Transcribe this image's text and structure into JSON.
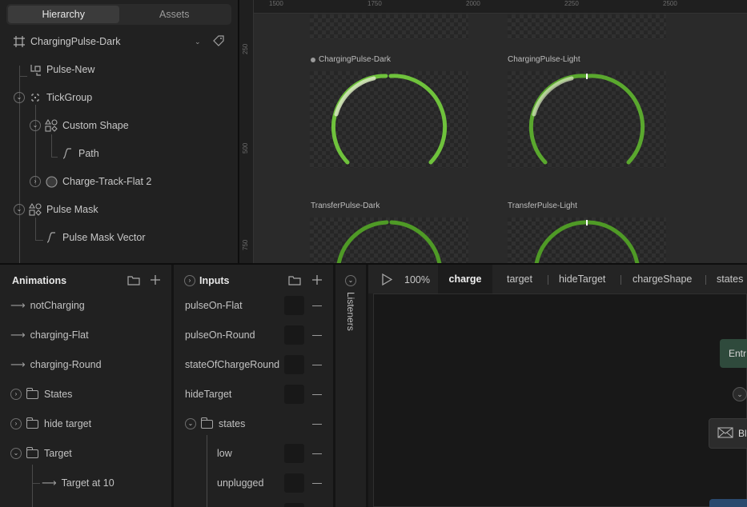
{
  "hierarchy": {
    "tabs": [
      "Hierarchy",
      "Assets"
    ],
    "artboard_name": "ChargingPulse-Dark",
    "items": [
      {
        "label": "Pulse-New",
        "icon": "bone-icon"
      },
      {
        "label": "TickGroup",
        "icon": "group-icon"
      },
      {
        "label": "Custom Shape",
        "icon": "shape-icon"
      },
      {
        "label": "Path",
        "icon": "path-icon"
      },
      {
        "label": "Charge-Track-Flat 2",
        "icon": "ellipse-icon"
      },
      {
        "label": "Pulse Mask",
        "icon": "shape-icon"
      },
      {
        "label": "Pulse Mask Vector",
        "icon": "path-icon"
      }
    ]
  },
  "canvas": {
    "ruler_x": [
      "1500",
      "1750",
      "2000",
      "2250",
      "2500"
    ],
    "ruler_y": [
      "250",
      "500",
      "750"
    ],
    "artboards": [
      "ChargingPulse-Dark",
      "ChargingPulse-Light",
      "TransferPulse-Dark",
      "TransferPulse-Light"
    ],
    "colors": {
      "arc_bright": "#6fc23c",
      "arc_dark": "#4f9a26",
      "highlight": "#d8e8c0"
    }
  },
  "animations": {
    "title": "Animations",
    "items": [
      {
        "label": "notCharging",
        "type": "animation"
      },
      {
        "label": "charging-Flat",
        "type": "animation"
      },
      {
        "label": "charging-Round",
        "type": "animation"
      },
      {
        "label": "States",
        "type": "folder"
      },
      {
        "label": "hide target",
        "type": "folder"
      },
      {
        "label": "Target",
        "type": "folder"
      },
      {
        "label": "Target at 10",
        "type": "animation"
      }
    ]
  },
  "inputs": {
    "title": "Inputs",
    "items": [
      {
        "label": "pulseOn-Flat"
      },
      {
        "label": "pulseOn-Round"
      },
      {
        "label": "stateOfChargeRound"
      },
      {
        "label": "hideTarget"
      },
      {
        "label": "states"
      },
      {
        "label": "low"
      },
      {
        "label": "unplugged"
      }
    ]
  },
  "listeners": {
    "title": "Listeners"
  },
  "state_machine": {
    "zoom": "100%",
    "tabs": [
      "charge",
      "target",
      "hideTarget",
      "chargeShape",
      "states"
    ],
    "nodes": {
      "entry": "Entr",
      "blend": "Bl"
    },
    "colors": {
      "entry": "#2f4a3c",
      "blend": "#2c2c2c",
      "blue": "#2b4a6e"
    }
  }
}
